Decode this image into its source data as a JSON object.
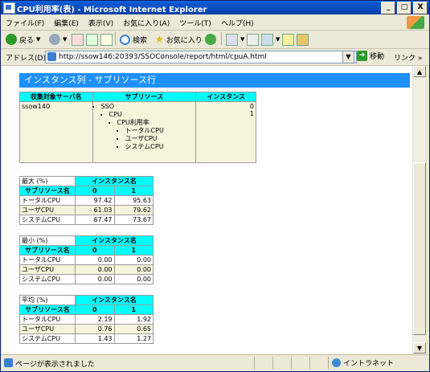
{
  "window": {
    "title": "CPU利用率(表) - Microsoft Internet Explorer",
    "minimize_label": "_",
    "maximize_label": "□",
    "close_label": "X"
  },
  "menu": {
    "items": [
      "ファイル(F)",
      "編集(E)",
      "表示(V)",
      "お気に入り(A)",
      "ツール(T)",
      "ヘルプ(H)"
    ]
  },
  "toolbar": {
    "back_label": "戻る",
    "search_label": "検索",
    "favorites_label": "お気に入り"
  },
  "address": {
    "label": "アドレス(D)",
    "url": "http://ssow146:20393/SSOConsole/report/html/cpuA.html",
    "go_label": "移動",
    "links_label": "リンク »"
  },
  "page": {
    "banner": "インスタンス列 - サブリソース行",
    "summary": {
      "headers": [
        "収集対象サーバ名",
        "サブリソース",
        "インスタンス"
      ],
      "server": "ssow140",
      "tree": {
        "level1": "SSO",
        "level2": "CPU",
        "level3": "CPU利用率",
        "leaves": [
          "トータルCPU",
          "ユーザCPU",
          "システムCPU"
        ]
      },
      "instances": [
        "0",
        "1"
      ]
    },
    "metric_tables": [
      {
        "caption": "最大 (%)",
        "instance_header": "インスタンス名",
        "subresource_header": "サブリソース名",
        "cols": [
          "0",
          "1"
        ],
        "rows": [
          {
            "name": "トータルCPU",
            "v0": "97.42",
            "v1": "95.63"
          },
          {
            "name": "ユーザCPU",
            "v0": "61.03",
            "v1": "79.62"
          },
          {
            "name": "システムCPU",
            "v0": "67.47",
            "v1": "73.67"
          }
        ]
      },
      {
        "caption": "最小 (%)",
        "instance_header": "インスタンス名",
        "subresource_header": "サブリソース名",
        "cols": [
          "0",
          "1"
        ],
        "rows": [
          {
            "name": "トータルCPU",
            "v0": "0.00",
            "v1": "0.00"
          },
          {
            "name": "ユーザCPU",
            "v0": "0.00",
            "v1": "0.00"
          },
          {
            "name": "システムCPU",
            "v0": "0.00",
            "v1": "0.00"
          }
        ]
      },
      {
        "caption": "平均 (%)",
        "instance_header": "インスタンス名",
        "subresource_header": "サブリソース名",
        "cols": [
          "0",
          "1"
        ],
        "rows": [
          {
            "name": "トータルCPU",
            "v0": "2.19",
            "v1": "1.92"
          },
          {
            "name": "ユーザCPU",
            "v0": "0.76",
            "v1": "0.65"
          },
          {
            "name": "システムCPU",
            "v0": "1.43",
            "v1": "1.27"
          }
        ]
      }
    ]
  },
  "status": {
    "text": "ページが表示されました",
    "zone": "イントラネット"
  },
  "colors": {
    "banner": "#1e90ff",
    "header_cell": "#00ffff",
    "alt_row": "#f5f5dc"
  }
}
